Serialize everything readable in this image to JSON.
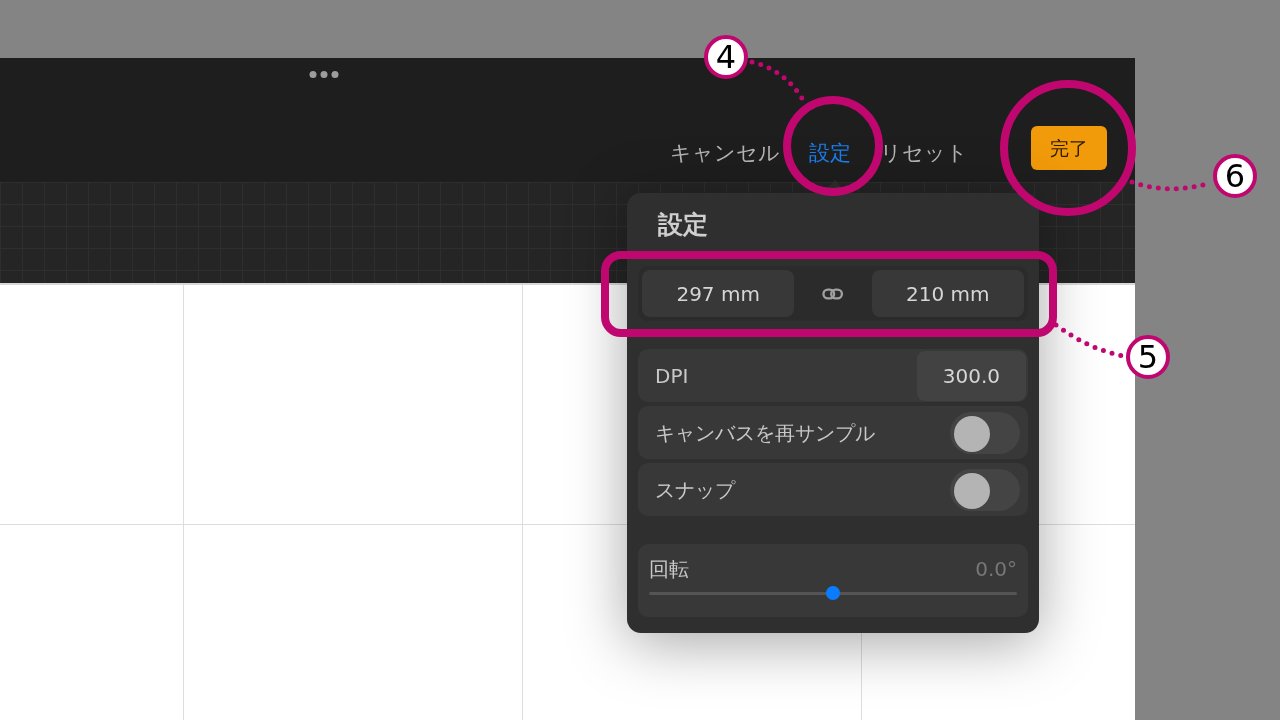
{
  "toolbar": {
    "buttons": [
      {
        "label": "キャンセル",
        "selected": false
      },
      {
        "label": "設定",
        "selected": true
      },
      {
        "label": "リセット",
        "selected": false
      }
    ],
    "done_button": "完了"
  },
  "settings_panel": {
    "title": "設定",
    "width": "297 mm",
    "height": "210 mm",
    "rows": [
      {
        "kind": "value",
        "label": "DPI",
        "value": "300.0"
      },
      {
        "kind": "toggle",
        "label": "キャンバスを再サンプル",
        "on": false
      },
      {
        "kind": "toggle",
        "label": "スナップ",
        "on": false
      }
    ],
    "rotation": {
      "label": "回転",
      "reading": "0.0°",
      "level": 0.5
    }
  },
  "annotations": [
    {
      "number": "4"
    },
    {
      "number": "5"
    },
    {
      "number": "6"
    }
  ]
}
